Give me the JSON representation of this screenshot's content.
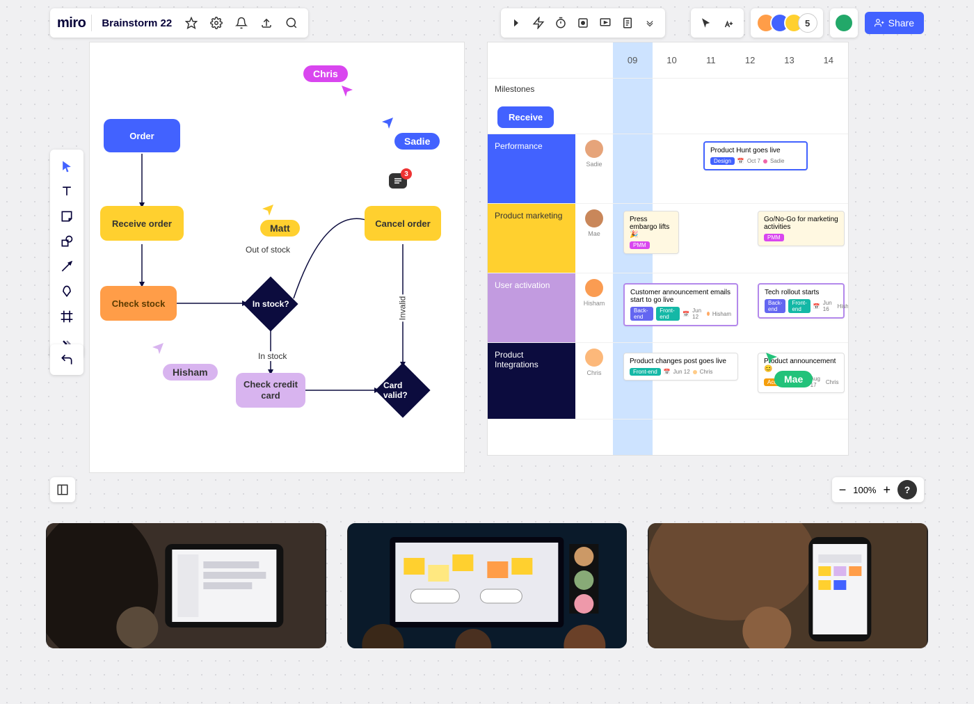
{
  "app": {
    "logo": "miro",
    "title": "Brainstorm 22"
  },
  "share": "Share",
  "avatar_count": "5",
  "zoom": "100%",
  "comment_count": "3",
  "flowchart": {
    "order": "Order",
    "receive": "Receive order",
    "check_stock": "Check stock",
    "in_stock_q": "In stock?",
    "cancel": "Cancel order",
    "check_card": "Check credit card",
    "card_valid_q": "Card valid?",
    "lbl_out": "Out of stock",
    "lbl_in": "In stock",
    "lbl_invalid": "Invalid"
  },
  "cursors": {
    "chris": "Chris",
    "sadie": "Sadie",
    "matt": "Matt",
    "hisham": "Hisham",
    "mae": "Mae"
  },
  "timeline": {
    "cols": [
      "09",
      "10",
      "11",
      "12",
      "13",
      "14"
    ],
    "row_milestone_label": "Milestones",
    "receive_pill": "Receive",
    "rows": [
      {
        "label": "Performance",
        "color": "#4262ff",
        "avatar": "#e6a",
        "name": "Sadie"
      },
      {
        "label": "Product marketing",
        "color": "#ffd02f",
        "avatar": "#c96",
        "name": "Mae",
        "textcolor": "#333"
      },
      {
        "label": "User activation",
        "color": "#c29be0",
        "avatar": "#fa6",
        "name": "Hisham"
      },
      {
        "label": "Product Integrations",
        "color": "#0c0c3e",
        "avatar": "#fc8",
        "name": "Chris"
      }
    ],
    "cards": {
      "perf": {
        "title": "Product Hunt goes live",
        "tag": "Design",
        "tagc": "#4262ff",
        "meta": "Oct 7",
        "who": "Sadie"
      },
      "pm1": {
        "title": "Press embargo lifts 🎉",
        "tag": "PMM",
        "tagc": "#d946ef"
      },
      "pm2": {
        "title": "Go/No-Go for marketing activities",
        "tag": "PMM",
        "tagc": "#d946ef"
      },
      "ua1": {
        "title": "Customer announcement emails start to go live",
        "tag1": "Back-end",
        "tagc1": "#6366f1",
        "tag2": "Front-end",
        "tagc2": "#14b8a6",
        "meta": "Jun 12",
        "who": "Hisham"
      },
      "ua2": {
        "title": "Tech rollout starts",
        "tag1": "Back-end",
        "tagc1": "#6366f1",
        "tag2": "Front-end",
        "tagc2": "#14b8a6",
        "meta": "Jun 16",
        "who": "Hisham"
      },
      "pi1": {
        "title": "Product changes post goes live",
        "tag": "Front-end",
        "tagc": "#14b8a6",
        "meta": "Jun 12",
        "who": "Chris"
      },
      "pi2": {
        "title": "Product announcement 😊",
        "tag": "Acquisition",
        "tagc": "#f59e0b",
        "meta": "Aug 17",
        "who": "Chris"
      }
    }
  }
}
